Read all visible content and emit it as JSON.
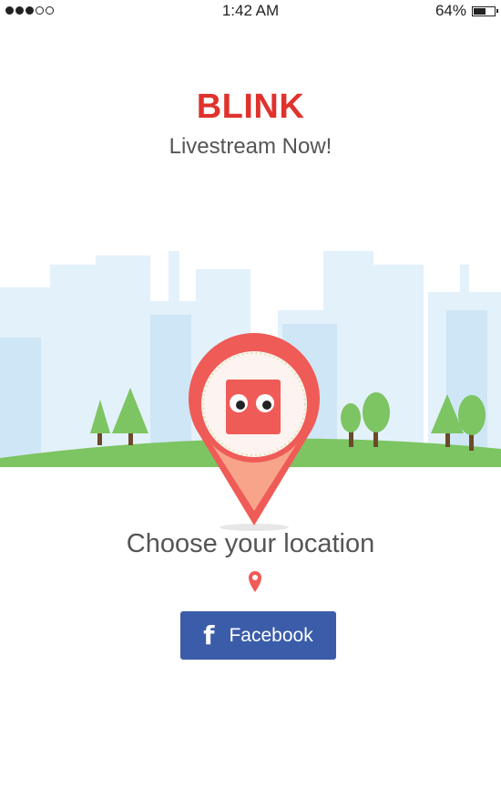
{
  "status_bar": {
    "time": "1:42 AM",
    "battery_text": "64%",
    "battery_level": 0.64,
    "signal_bars_filled": 3,
    "signal_bars_total": 5
  },
  "app": {
    "title": "BLINK",
    "subtitle": "Livestream Now!"
  },
  "main": {
    "choose_location": "Choose your location",
    "small_pin_icon": "location-pin-icon"
  },
  "login": {
    "facebook_label": "Facebook",
    "facebook_icon": "facebook-f-icon"
  },
  "colors": {
    "brand_red": "#e0322d",
    "pin_red": "#ef5b57",
    "facebook_blue": "#3b5ca8",
    "grass_green": "#7dc462",
    "sky_building": "#dbeefa"
  }
}
